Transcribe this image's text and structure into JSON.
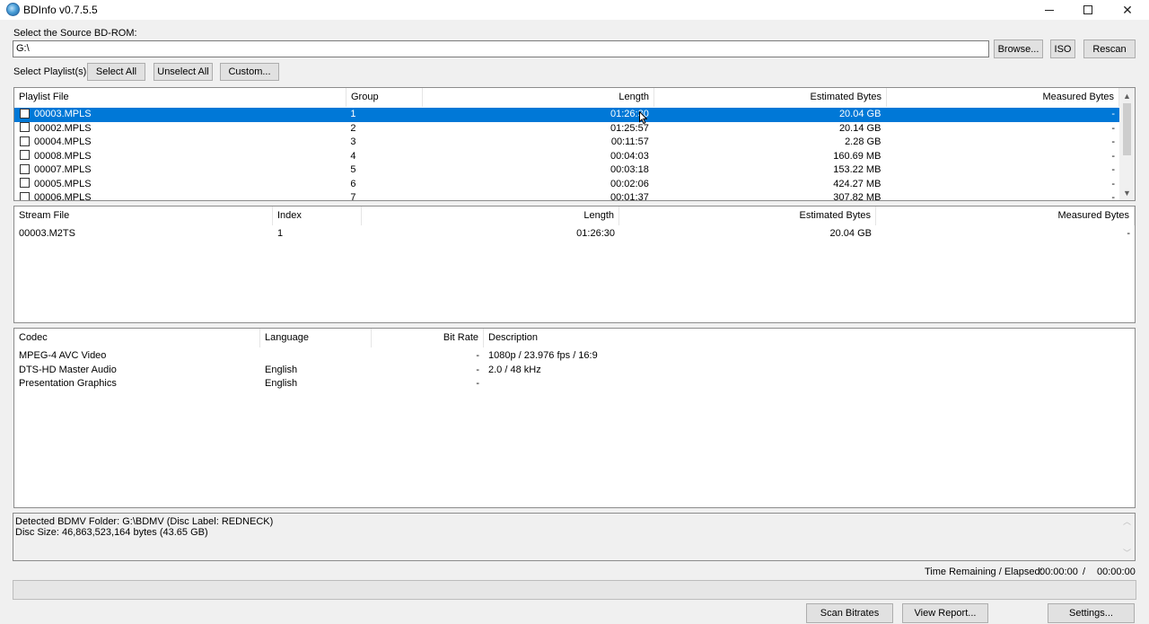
{
  "window": {
    "title": "BDInfo v0.7.5.5"
  },
  "source": {
    "label": "Select the Source BD-ROM:",
    "path": "G:\\",
    "browse_label": "Browse...",
    "iso_label": "ISO",
    "rescan_label": "Rescan"
  },
  "playlist_select": {
    "label": "Select Playlist(s):",
    "select_all_label": "Select All",
    "unselect_all_label": "Unselect All",
    "custom_label": "Custom..."
  },
  "playlists": {
    "columns": [
      "Playlist File",
      "Group",
      "Length",
      "Estimated Bytes",
      "Measured Bytes"
    ],
    "rows": [
      {
        "file": "00003.MPLS",
        "group": "1",
        "length": "01:26:30",
        "estimated": "20.04 GB",
        "measured": "-",
        "selected": true
      },
      {
        "file": "00002.MPLS",
        "group": "2",
        "length": "01:25:57",
        "estimated": "20.14 GB",
        "measured": "-"
      },
      {
        "file": "00004.MPLS",
        "group": "3",
        "length": "00:11:57",
        "estimated": "2.28 GB",
        "measured": "-"
      },
      {
        "file": "00008.MPLS",
        "group": "4",
        "length": "00:04:03",
        "estimated": "160.69 MB",
        "measured": "-"
      },
      {
        "file": "00007.MPLS",
        "group": "5",
        "length": "00:03:18",
        "estimated": "153.22 MB",
        "measured": "-"
      },
      {
        "file": "00005.MPLS",
        "group": "6",
        "length": "00:02:06",
        "estimated": "424.27 MB",
        "measured": "-"
      },
      {
        "file": "00006.MPLS",
        "group": "7",
        "length": "00:01:37",
        "estimated": "307.82 MB",
        "measured": "-"
      }
    ]
  },
  "streams": {
    "columns": [
      "Stream File",
      "Index",
      "Length",
      "Estimated Bytes",
      "Measured Bytes"
    ],
    "rows": [
      {
        "file": "00003.M2TS",
        "index": "1",
        "length": "01:26:30",
        "estimated": "20.04 GB",
        "measured": "-"
      }
    ]
  },
  "codecs": {
    "columns": [
      "Codec",
      "Language",
      "Bit Rate",
      "Description"
    ],
    "rows": [
      {
        "codec": "MPEG-4 AVC Video",
        "language": "",
        "bitrate": "-",
        "description": "1080p / 23.976 fps / 16:9"
      },
      {
        "codec": "DTS-HD Master Audio",
        "language": "English",
        "bitrate": "-",
        "description": "2.0 / 48 kHz"
      },
      {
        "codec": "Presentation Graphics",
        "language": "English",
        "bitrate": "-",
        "description": ""
      }
    ]
  },
  "info": {
    "line1": "Detected BDMV Folder: G:\\BDMV (Disc Label: REDNECK)",
    "line2": "Disc Size: 46,863,523,164 bytes (43.65 GB)"
  },
  "status": {
    "time_label": "Time Remaining / Elapsed:",
    "remaining": "00:00:00",
    "separator": "/",
    "elapsed": "00:00:00",
    "progress_percent": 0
  },
  "actions": {
    "scan_bitrates_label": "Scan Bitrates",
    "view_report_label": "View Report...",
    "settings_label": "Settings..."
  }
}
